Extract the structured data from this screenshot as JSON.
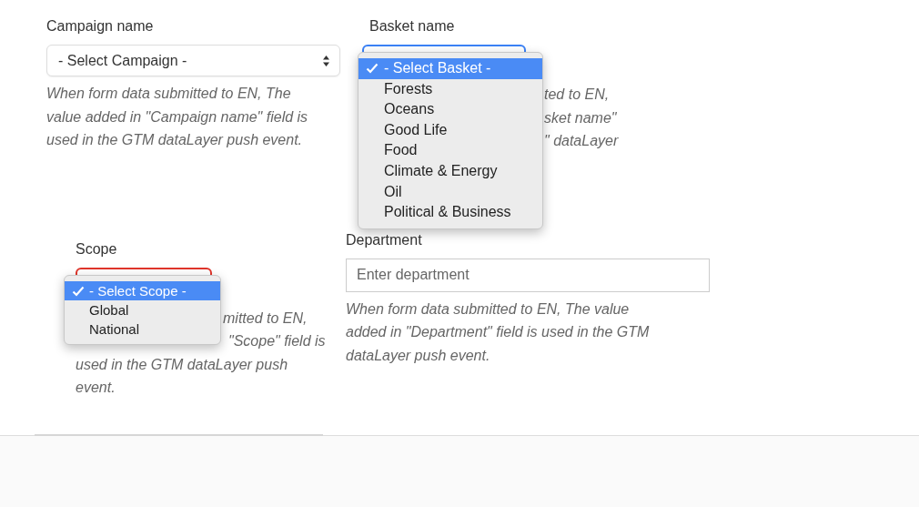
{
  "fields": [
    {
      "label": "Campaign name",
      "kind": "select",
      "value": "- Select Campaign -",
      "open": false,
      "help": [
        "When form data submitted to EN, The",
        "value added in \"Campaign name\" field is",
        "used in the GTM dataLayer push event."
      ]
    },
    {
      "label": "Basket name",
      "kind": "select",
      "open": true,
      "options": [
        {
          "label": "- Select Basket -",
          "selected": true
        },
        {
          "label": "Forests",
          "selected": false
        },
        {
          "label": "Oceans",
          "selected": false
        },
        {
          "label": "Good Life",
          "selected": false
        },
        {
          "label": "Food",
          "selected": false
        },
        {
          "label": "Climate & Energy",
          "selected": false
        },
        {
          "label": "Oil",
          "selected": false
        },
        {
          "label": "Political & Business",
          "selected": false
        }
      ],
      "help": [
        "ted to EN,",
        "sket name\"",
        "\" dataLayer"
      ]
    },
    {
      "label": "Scope",
      "kind": "select",
      "open": true,
      "invalid": true,
      "options": [
        {
          "label": "- Select Scope -",
          "selected": true
        },
        {
          "label": "Global",
          "selected": false
        },
        {
          "label": "National",
          "selected": false
        }
      ],
      "help": [
        "mitted to EN,",
        "\"Scope\" field is",
        "used in the GTM dataLayer push",
        "event."
      ]
    },
    {
      "label": "Department",
      "kind": "text",
      "placeholder": "Enter department",
      "help": [
        "When form data submitted to EN, The value",
        "added in \"Department\" field is used in the GTM",
        "dataLayer push event."
      ]
    }
  ]
}
